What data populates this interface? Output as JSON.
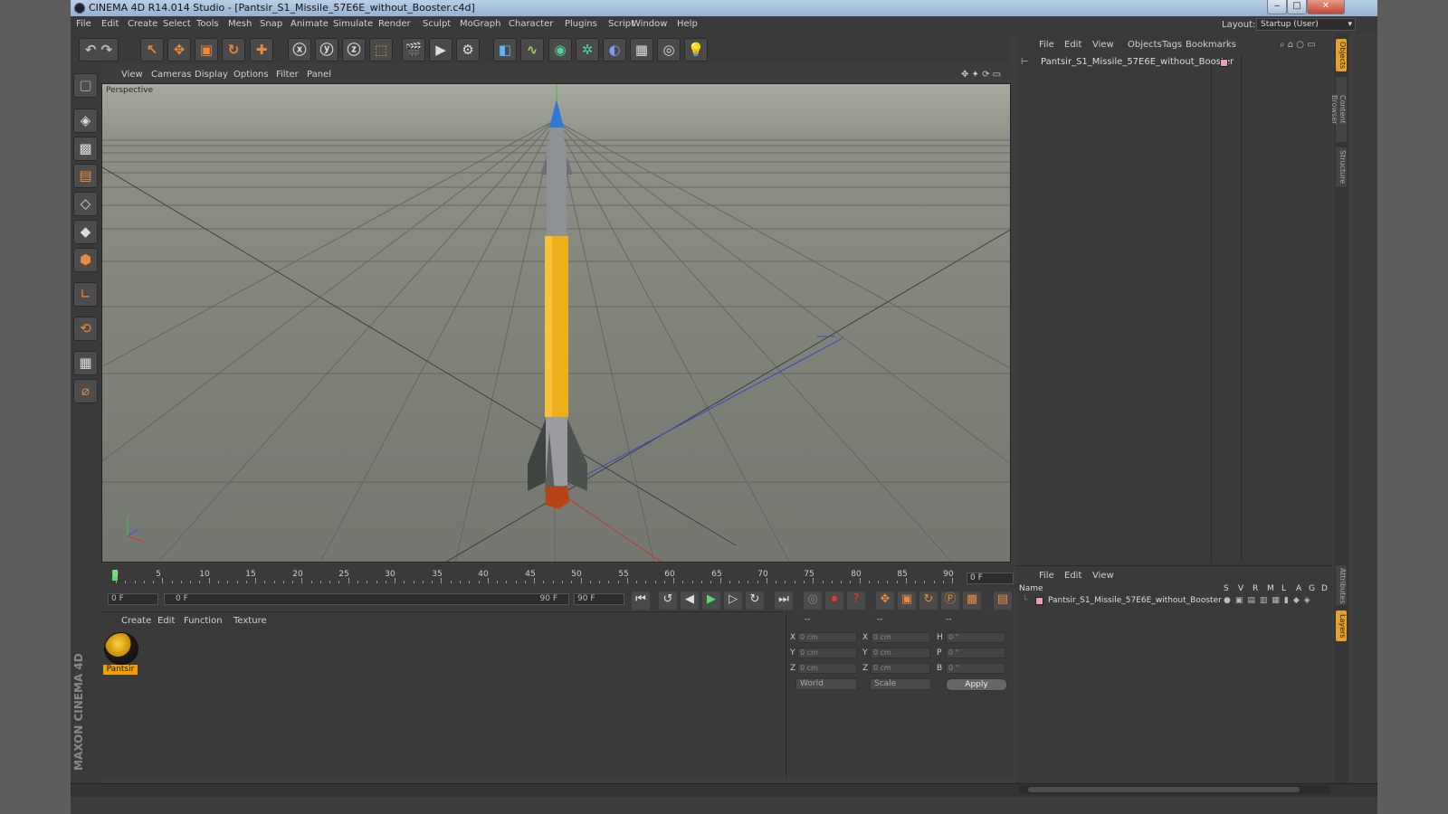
{
  "window": {
    "title": "CINEMA 4D R14.014 Studio - [Pantsir_S1_Missile_57E6E_without_Booster.c4d]",
    "min_glyph": "‒",
    "max_glyph": "□",
    "close_glyph": "✕"
  },
  "menubar": [
    "File",
    "Edit",
    "Create",
    "Select",
    "Tools",
    "Mesh",
    "Snap",
    "Animate",
    "Simulate",
    "Render",
    "Sculpt",
    "MoGraph",
    "Character",
    "Plugins",
    "Script",
    "Window",
    "Help"
  ],
  "layout": {
    "label": "Layout:",
    "value": "Startup (User)"
  },
  "viewport": {
    "menu": [
      "View",
      "Cameras",
      "Display",
      "Options",
      "Filter",
      "Panel"
    ],
    "label": "Perspective"
  },
  "timeline": {
    "labels": [
      "0",
      "5",
      "10",
      "15",
      "20",
      "25",
      "30",
      "35",
      "40",
      "45",
      "50",
      "55",
      "60",
      "65",
      "70",
      "75",
      "80",
      "85",
      "90"
    ],
    "current_frame": "0 F"
  },
  "playback": {
    "start_field": "0 F",
    "range_start": "0 F",
    "range_end": "90 F",
    "end_field": "90 F"
  },
  "material_manager": {
    "menu": [
      "Create",
      "Edit",
      "Function",
      "Texture"
    ],
    "material_name": "Pantsir"
  },
  "coordinates": {
    "header": [
      "--",
      "--",
      "--"
    ],
    "rows": [
      {
        "a": "X",
        "av": "0 cm",
        "b": "X",
        "bv": "0 cm",
        "c": "H",
        "cv": "0 °"
      },
      {
        "a": "Y",
        "av": "0 cm",
        "b": "Y",
        "bv": "0 cm",
        "c": "P",
        "cv": "0 °"
      },
      {
        "a": "Z",
        "av": "0 cm",
        "b": "Z",
        "bv": "0 cm",
        "c": "B",
        "cv": "0 °"
      }
    ],
    "world": "World",
    "scale": "Scale",
    "apply": "Apply"
  },
  "object_manager": {
    "menu": [
      "File",
      "Edit",
      "View",
      "Objects",
      "Tags",
      "Bookmarks"
    ],
    "object": "Pantsir_S1_Missile_57E6E_without_Booster"
  },
  "attribute_manager": {
    "menu": [
      "File",
      "Edit",
      "View"
    ],
    "columns": {
      "name": "Name",
      "flags": [
        "S",
        "V",
        "R",
        "M",
        "L",
        "A",
        "G",
        "D"
      ]
    },
    "row": "Pantsir_S1_Missile_57E6E_without_Booster"
  },
  "side_tabs": [
    "Objects",
    "Content Browser",
    "Structure",
    "Attributes",
    "Layers"
  ],
  "branding": "MAXON CINEMA 4D",
  "colors": {
    "accent": "#f0a000",
    "tag": "#e4a0b9",
    "timeline_cursor": "#5ad86b"
  }
}
